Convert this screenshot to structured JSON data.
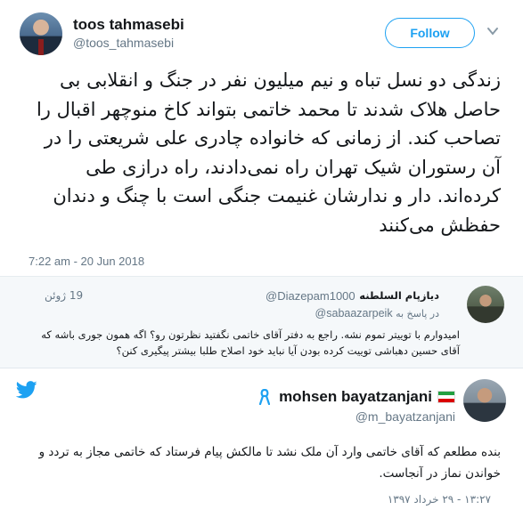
{
  "tweet1": {
    "author_name": "toos tahmasebi",
    "author_handle": "@toos_tahmasebi",
    "follow_label": "Follow",
    "text": "زندگی دو نسل تباه و نیم میلیون نفر در جنگ و انقلابی بی حاصل هلاک شدند تا محمد خاتمی بتواند کاخ منوچهر اقبال را تصاحب کند. از زمانی که خانواده چادری علی شریعتی را در آن رستوران شیک تهران راه نمی‌دادند، راه درازی طی کرده‌اند. دار و ندارشان غنیمت جنگی است با چنگ و دندان حفظش می‌کنند",
    "timestamp": "7:22 am - 20 Jun 2018"
  },
  "tweet2": {
    "author_name": "دیازپام السلطنه",
    "author_handle": "@Diazepam1000",
    "date": "19 ژوئن",
    "reply_prefix": "در پاسخ به",
    "reply_handle": "@sabaazarpeik",
    "text": "امیدوارم با توییتر تموم نشه. راجع به دفتر آقای خاتمی نگفتید نظرتون رو؟ اگه همون جوری باشه که آقای حسین دهباشی توییت کرده بودن آیا نباید خود اصلاح طلبا بیشتر پیگیری کنن؟"
  },
  "tweet3": {
    "author_name": "mohsen bayatzanjani",
    "author_handle": "@m_bayatzanjani",
    "text": "بنده مطلعم که آقای خاتمی وارد آن ملک نشد تا مالکش پیام فرستاد که خاتمی مجاز به تردد و خواندن نماز در آنجاست.",
    "date": "۱۳:۲۷ - ۲۹ خرداد ۱۳۹۷"
  },
  "colors": {
    "twitter_blue": "#1da1f2",
    "muted_gray": "#657786",
    "reply_bg": "#f5f8fa"
  },
  "icons": [
    "chevron-down-icon",
    "twitter-bird-icon",
    "iran-flag-icon",
    "awareness-ribbon-icon"
  ]
}
